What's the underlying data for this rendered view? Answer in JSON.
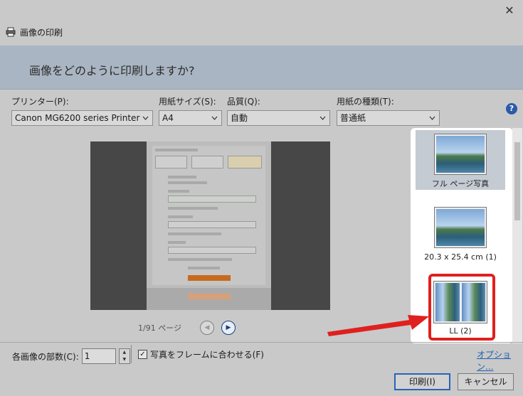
{
  "window": {
    "title": "画像の印刷",
    "close_symbol": "✕"
  },
  "banner": {
    "question": "画像をどのように印刷しますか?"
  },
  "settings": {
    "printer": {
      "label": "プリンター(P):",
      "value": "Canon MG6200 series Printer"
    },
    "paper_size": {
      "label": "用紙サイズ(S):",
      "value": "A4"
    },
    "quality": {
      "label": "品質(Q):",
      "value": "自動"
    },
    "paper_type": {
      "label": "用紙の種類(T):",
      "value": "普通紙"
    },
    "help_symbol": "?"
  },
  "preview": {
    "page_indicator": "1/91 ページ",
    "prev_symbol": "◀",
    "next_symbol": "▶"
  },
  "print_sizes": [
    {
      "label": "フル ページ写真",
      "icon": "landscape-photo-icon",
      "selected": true
    },
    {
      "label": "20.3 x 25.4 cm (1)",
      "icon": "landscape-photo-icon",
      "selected": false
    },
    {
      "label": "LL (2)",
      "icon": "two-portrait-photos-icon",
      "selected": false,
      "highlighted": true
    }
  ],
  "bottom": {
    "copies_label": "各画像の部数(C):",
    "copies_value": "1",
    "fit_frame_label": "写真をフレームに合わせる(F)",
    "fit_frame_checked": true,
    "check_symbol": "✓",
    "options_link": "オプション...",
    "print_button": "印刷(I)",
    "cancel_button": "キャンセル"
  },
  "colors": {
    "highlight": "#e0201e",
    "link": "#1f5fb0",
    "accent": "#2b62b8"
  }
}
